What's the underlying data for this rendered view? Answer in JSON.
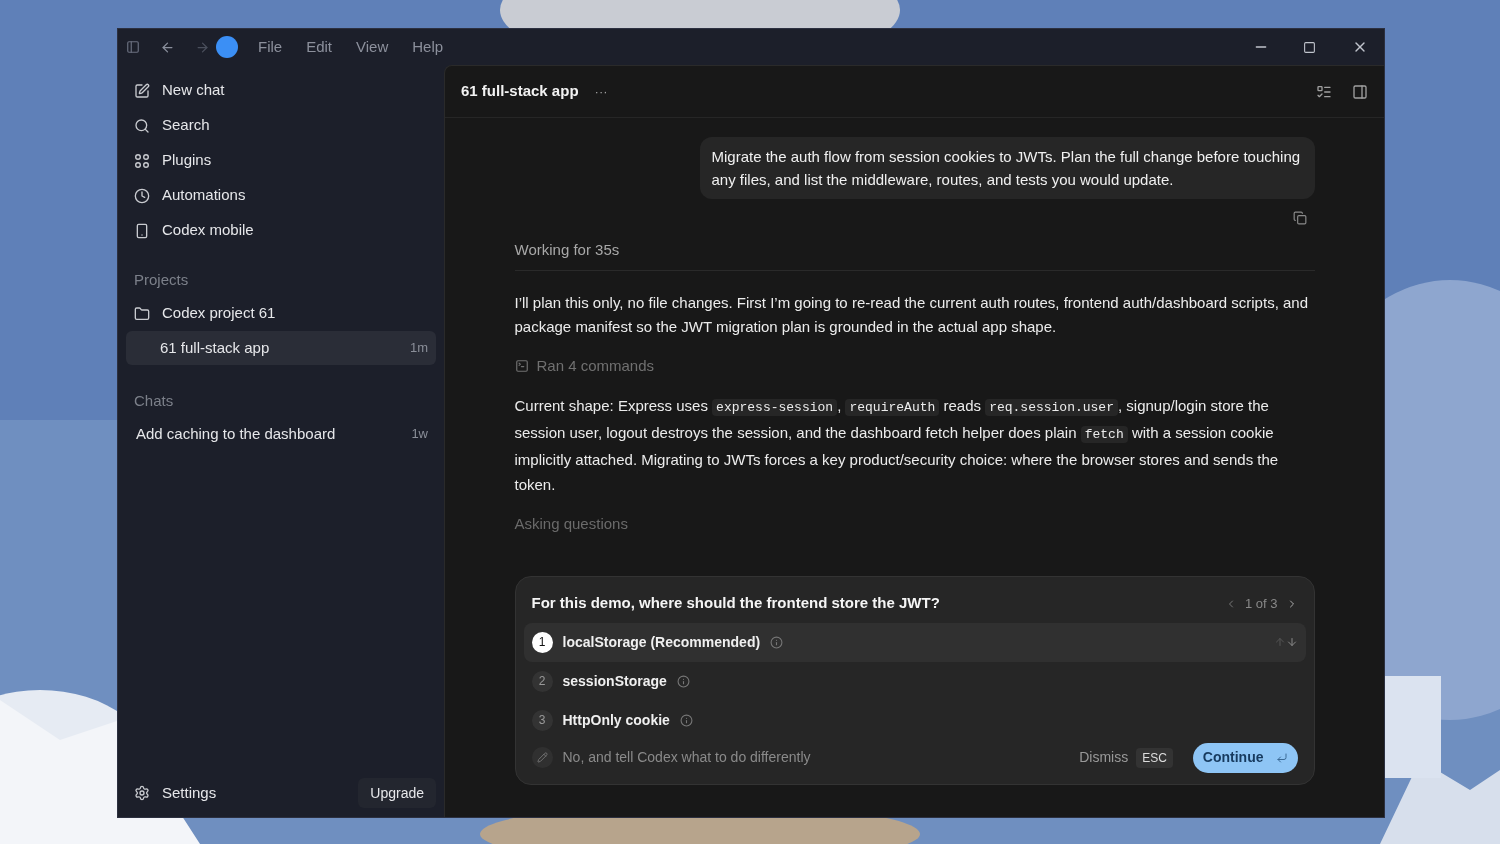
{
  "menu": [
    "File",
    "Edit",
    "View",
    "Help"
  ],
  "sidebar": {
    "nav": [
      {
        "kind": "edit",
        "label": "New chat"
      },
      {
        "kind": "search",
        "label": "Search"
      },
      {
        "kind": "plugins",
        "label": "Plugins"
      },
      {
        "kind": "clock",
        "label": "Automations"
      },
      {
        "kind": "mobile",
        "label": "Codex mobile"
      }
    ],
    "projects_heading": "Projects",
    "project": {
      "label": "Codex project 61",
      "threads": [
        {
          "label": "61 full-stack app",
          "age": "1m",
          "selected": true
        }
      ]
    },
    "chats_heading": "Chats",
    "chats": [
      {
        "label": "Add caching to the dashboard",
        "age": "1w",
        "selected": false
      }
    ],
    "settings": "Settings",
    "upgrade": "Upgrade"
  },
  "thread": {
    "title": "61 full-stack app",
    "more": "···",
    "user_message": "Migrate the auth flow from session cookies to JWTs. Plan the full change before touching any files, and list the middleware, routes, and tests you would update.",
    "working": "Working for 35s",
    "intro": "I’ll plan this only, no file changes. First I’m going to re-read the current auth routes, frontend auth/dashboard scripts, and package manifest so the JWT migration plan is grounded in the actual app shape.",
    "ran": "Ran 4 commands",
    "summary": [
      {
        "kind": "text",
        "text": "Current shape: Express uses "
      },
      {
        "kind": "code",
        "text": "express-session"
      },
      {
        "kind": "text",
        "text": ", "
      },
      {
        "kind": "code",
        "text": "requireAuth"
      },
      {
        "kind": "text",
        "text": " reads "
      },
      {
        "kind": "code",
        "text": "req.session.user"
      },
      {
        "kind": "text",
        "text": ", signup/login store the session user, logout destroys the session, and the dashboard fetch helper does plain "
      },
      {
        "kind": "code",
        "text": "fetch"
      },
      {
        "kind": "text",
        "text": " with a session cookie implicitly attached. Migrating to JWTs forces a key product/security choice: where the browser stores and sends the token."
      }
    ],
    "asking": "Asking questions"
  },
  "question": {
    "title": "For this demo, where should the frontend store the JWT?",
    "pager": "1 of 3",
    "options": [
      {
        "number": "1",
        "label": "localStorage (Recommended)",
        "selected": true
      },
      {
        "number": "2",
        "label": "sessionStorage",
        "selected": false
      },
      {
        "number": "3",
        "label": "HttpOnly cookie",
        "selected": false
      }
    ],
    "other_placeholder": "No, and tell Codex what to do differently",
    "dismiss": "Dismiss",
    "esc": "ESC",
    "continue": "Continue"
  }
}
